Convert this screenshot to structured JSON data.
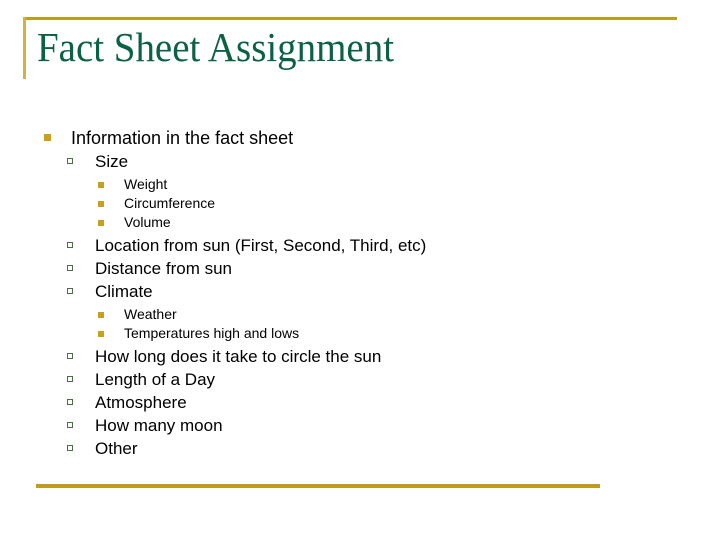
{
  "slide": {
    "title": "Fact Sheet Assignment",
    "title_color": "#0B6145",
    "accent_gold": "#BF9B1F",
    "bullet_gold": "#C8A01E",
    "bullet_hollow_border": "#4F6B4A",
    "background": "#FFFFFF"
  },
  "outline": [
    {
      "level": 1,
      "text": "Information in the fact sheet"
    },
    {
      "level": 2,
      "text": "Size"
    },
    {
      "level": 3,
      "text": "Weight"
    },
    {
      "level": 3,
      "text": "Circumference"
    },
    {
      "level": 3,
      "text": "Volume"
    },
    {
      "level": 2,
      "text": "Location from sun (First, Second, Third, etc)"
    },
    {
      "level": 2,
      "text": "Distance from sun"
    },
    {
      "level": 2,
      "text": "Climate"
    },
    {
      "level": 3,
      "text": "Weather"
    },
    {
      "level": 3,
      "text": "Temperatures high and lows"
    },
    {
      "level": 2,
      "text": "How long does it take to circle the sun"
    },
    {
      "level": 2,
      "text": "Length of a Day"
    },
    {
      "level": 2,
      "text": "Atmosphere"
    },
    {
      "level": 2,
      "text": "How many moon"
    },
    {
      "level": 2,
      "text": "Other"
    }
  ]
}
